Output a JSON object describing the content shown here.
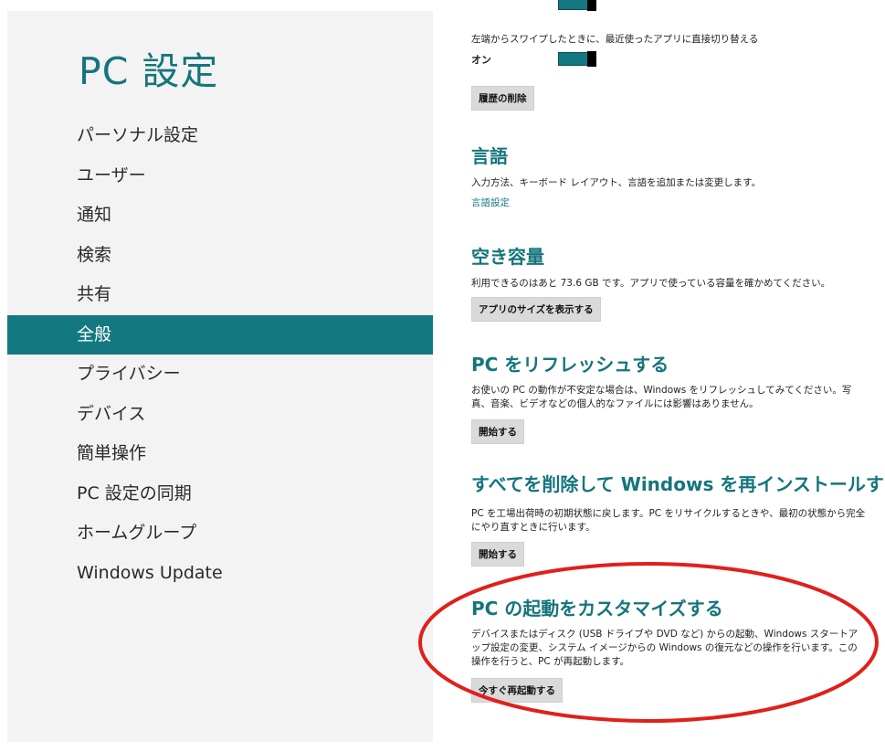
{
  "left": {
    "title": "PC 設定",
    "nav": [
      "パーソナル設定",
      "ユーザー",
      "通知",
      "検索",
      "共有",
      "全般",
      "プライバシー",
      "デバイス",
      "簡単操作",
      "PC 設定の同期",
      "ホームグループ",
      "Windows Update"
    ],
    "selected": "全般"
  },
  "switching": {
    "desc": "左端からスワイプしたときに、最近使ったアプリに直接切り替える",
    "toggle_state": "オン",
    "clear_button": "履歴の削除"
  },
  "language": {
    "title": "言語",
    "desc": "入力方法、キーボード レイアウト、言語を追加または変更します。",
    "link": "言語設定"
  },
  "storage": {
    "title": "空き容量",
    "desc": "利用できるのはあと 73.6 GB です。アプリで使っている容量を確かめてください。",
    "button": "アプリのサイズを表示する"
  },
  "refresh": {
    "title": "PC をリフレッシュする",
    "desc": "お使いの PC の動作が不安定な場合は、Windows をリフレッシュしてみてください。写真、音楽、ビデオなどの個人的なファイルには影響はありません。",
    "button": "開始する"
  },
  "reinstall": {
    "title": "すべてを削除して Windows を再インストールする",
    "desc": "PC を工場出荷時の初期状態に戻します。PC をリサイクルするときや、最初の状態から完全にやり直すときに行います。",
    "button": "開始する"
  },
  "startup": {
    "title": "PC の起動をカスタマイズする",
    "desc": "デバイスまたはディスク (USB ドライブや DVD など) からの起動、Windows スタートアップ設定の変更、システム イメージからの Windows の復元などの操作を行います。この操作を行うと、PC が再起動します。",
    "button": "今すぐ再起動する"
  },
  "colors": {
    "accent": "#137880",
    "title_text": "#15757c",
    "highlight_ellipse": "#e0201b"
  }
}
